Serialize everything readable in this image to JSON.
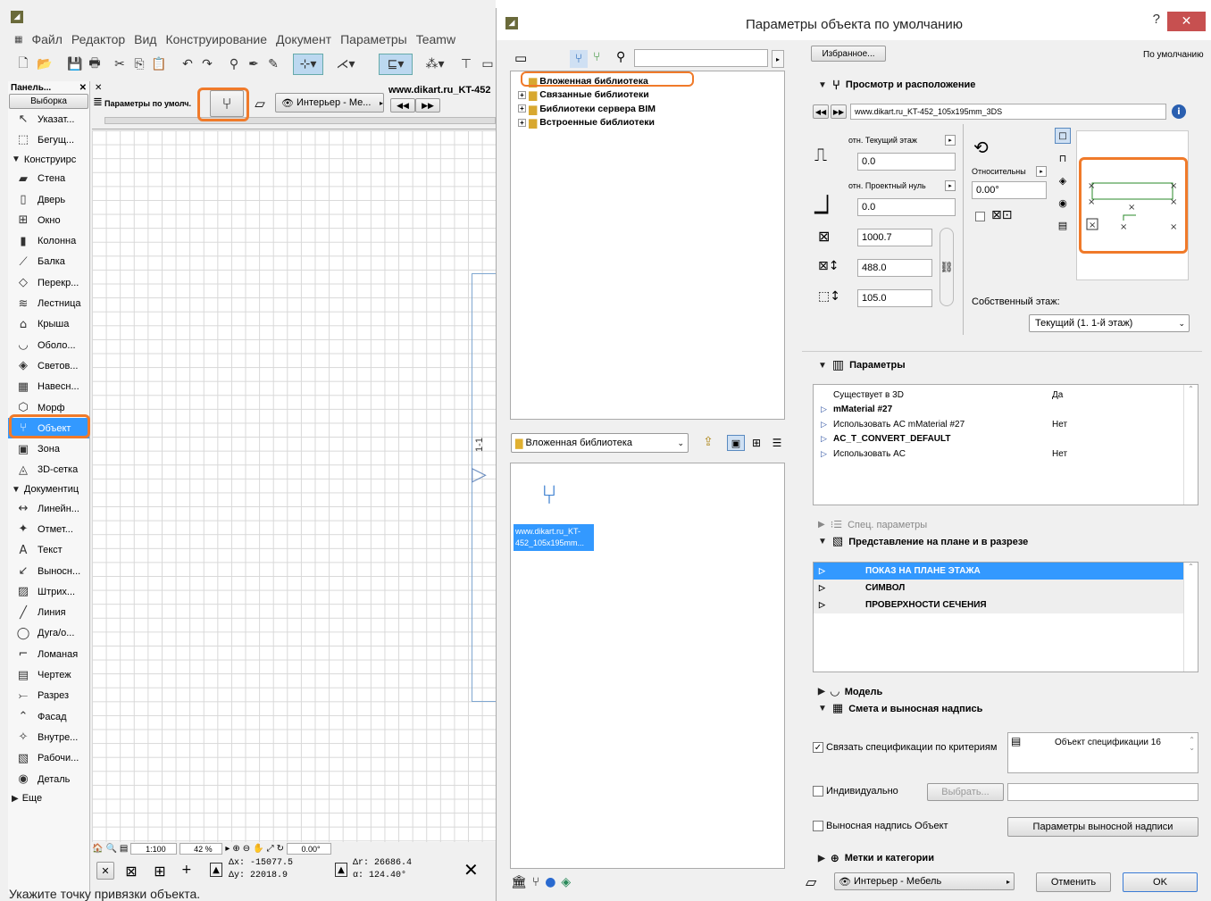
{
  "app": {
    "menu": [
      "Файл",
      "Редактор",
      "Вид",
      "Конструирование",
      "Документ",
      "Параметры",
      "Teamw"
    ]
  },
  "panel": {
    "title": "Панель...",
    "tab": "Выборка",
    "items": [
      {
        "label": "Указат...",
        "icon": "arrow-pointer-icon",
        "glyph": "↖"
      },
      {
        "label": "Бегущ...",
        "icon": "marquee-icon",
        "glyph": "⬚"
      },
      {
        "section": "Конструирс"
      },
      {
        "label": "Стена",
        "icon": "wall-icon",
        "glyph": "▰"
      },
      {
        "label": "Дверь",
        "icon": "door-icon",
        "glyph": "▯"
      },
      {
        "label": "Окно",
        "icon": "window-icon",
        "glyph": "⊞"
      },
      {
        "label": "Колонна",
        "icon": "column-icon",
        "glyph": "▮"
      },
      {
        "label": "Балка",
        "icon": "beam-icon",
        "glyph": "⟋"
      },
      {
        "label": "Перекр...",
        "icon": "slab-icon",
        "glyph": "◇"
      },
      {
        "label": "Лестница",
        "icon": "stair-icon",
        "glyph": "≋"
      },
      {
        "label": "Крыша",
        "icon": "roof-icon",
        "glyph": "⌂"
      },
      {
        "label": "Оболо...",
        "icon": "shell-icon",
        "glyph": "◡"
      },
      {
        "label": "Светов...",
        "icon": "skylight-icon",
        "glyph": "◈"
      },
      {
        "label": "Навесн...",
        "icon": "curtain-wall-icon",
        "glyph": "▦"
      },
      {
        "label": "Морф",
        "icon": "morph-icon",
        "glyph": "⬡"
      },
      {
        "label": "Объект",
        "icon": "object-chair-icon",
        "glyph": "⑂",
        "selected": true
      },
      {
        "label": "Зона",
        "icon": "zone-icon",
        "glyph": "▣"
      },
      {
        "label": "3D-сетка",
        "icon": "mesh-icon",
        "glyph": "◬"
      },
      {
        "section": "Документиц"
      },
      {
        "label": "Линейн...",
        "icon": "dimension-icon",
        "glyph": "↔"
      },
      {
        "label": "Отмет...",
        "icon": "level-dimension-icon",
        "glyph": "✦"
      },
      {
        "label": "Текст",
        "icon": "text-icon",
        "glyph": "A"
      },
      {
        "label": "Выносн...",
        "icon": "label-icon",
        "glyph": "↙"
      },
      {
        "label": "Штрих...",
        "icon": "fill-icon",
        "glyph": "▨"
      },
      {
        "label": "Линия",
        "icon": "line-icon",
        "glyph": "╱"
      },
      {
        "label": "Дуга/о...",
        "icon": "arc-icon",
        "glyph": "◯"
      },
      {
        "label": "Ломаная",
        "icon": "polyline-icon",
        "glyph": "⌐"
      },
      {
        "label": "Чертеж",
        "icon": "drawing-icon",
        "glyph": "▤"
      },
      {
        "label": "Разрез",
        "icon": "section-icon",
        "glyph": "⤚"
      },
      {
        "label": "Фасад",
        "icon": "elevation-icon",
        "glyph": "⌃"
      },
      {
        "label": "Внутре...",
        "icon": "interior-elevation-icon",
        "glyph": "✧"
      },
      {
        "label": "Рабочи...",
        "icon": "worksheet-icon",
        "glyph": "▧"
      },
      {
        "label": "Деталь",
        "icon": "detail-icon",
        "glyph": "◉"
      },
      {
        "section": "Еще",
        "collapsed": true
      }
    ]
  },
  "infobox": {
    "label": "Параметры по умолч.",
    "view": "Интерьер - Ме...",
    "url": "www.dikart.ru_KT-452"
  },
  "bottom": {
    "scale": "1:100",
    "zoom": "42 %",
    "angle": "0.00°"
  },
  "coords": {
    "dx": "Δx: -15077.5",
    "dy": "Δy: 22018.9",
    "dr": "Δr: 26686.4",
    "da": "α: 124.40°"
  },
  "status": "Укажите точку привязки объекта.",
  "dialog": {
    "title": "Параметры объекта по умолчанию",
    "tree": [
      "Вложенная библиотека",
      "Связанные библиотеки",
      "Библиотеки сервера BIM",
      "Встроенные библиотеки"
    ],
    "folder": "Вложенная библиотека",
    "thumb_label": "www.dikart.ru_KT-452_105x195mm...",
    "favorites": "Избранное...",
    "default": "По умолчанию",
    "sec_view": "Просмотр и расположение",
    "object_name": "www.dikart.ru_KT-452_105x195mm_3DS",
    "rel_story": "отн. Текущий этаж",
    "rel_zero": "отн. Проектный нуль",
    "relative": "Относительны",
    "v_elev1": "0.0",
    "v_elev2": "0.0",
    "v_angle": "0.00°",
    "v_a": "1000.7",
    "v_b": "488.0",
    "v_h": "105.0",
    "home_story_label": "Собственный этаж:",
    "home_story": "Текущий (1. 1-й этаж)",
    "sec_params": "Параметры",
    "params": [
      {
        "name": "Существует в 3D",
        "value": "Да",
        "bold": false,
        "arrow": false
      },
      {
        "name": "mMaterial #27",
        "value": "",
        "bold": true,
        "arrow": true
      },
      {
        "name": "Использовать AC mMaterial #27",
        "value": "Нет",
        "bold": false,
        "arrow": true
      },
      {
        "name": "AC_T_CONVERT_DEFAULT",
        "value": "",
        "bold": true,
        "arrow": true
      },
      {
        "name": "Использовать AC",
        "value": "Нет",
        "bold": false,
        "arrow": true
      }
    ],
    "sec_special": "Спец. параметры",
    "sec_plan": "Представление на плане и в разрезе",
    "plan_rows": [
      "ПОКАЗ НА ПЛАНЕ ЭТАЖА",
      "СИМВОЛ",
      "ПРОВЕРХНОСТИ СЕЧЕНИЯ"
    ],
    "sec_model": "Модель",
    "sec_listing": "Смета и выносная надпись",
    "link_specs": "Связать спецификации по критериям",
    "spec_object": "Объект спецификации 16",
    "individual": "Индивидуально",
    "choose": "Выбрать...",
    "label_object": "Выносная надпись Объект",
    "label_params": "Параметры выносной надписи",
    "sec_tags": "Метки и категории",
    "layer": "Интерьер - Мебель",
    "cancel": "Отменить",
    "ok": "OK"
  }
}
